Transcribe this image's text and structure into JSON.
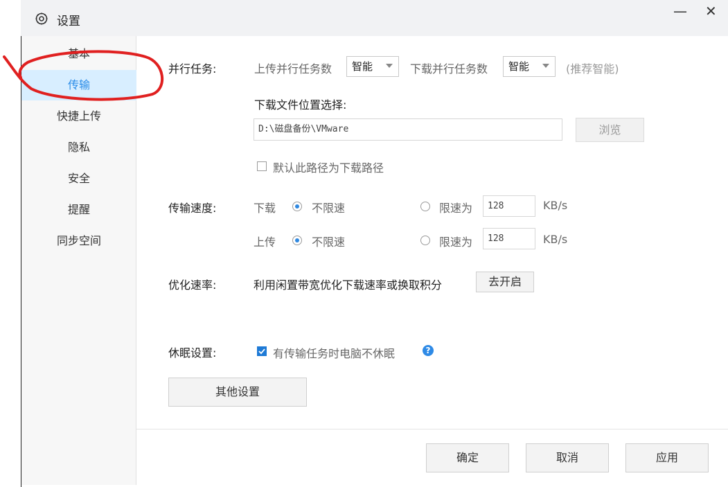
{
  "window": {
    "title": "设置",
    "minimize_glyph": "—",
    "close_glyph": "✕"
  },
  "sidebar": {
    "items": [
      {
        "label": "基本"
      },
      {
        "label": "传输"
      },
      {
        "label": "快捷上传"
      },
      {
        "label": "隐私"
      },
      {
        "label": "安全"
      },
      {
        "label": "提醒"
      },
      {
        "label": "同步空间"
      }
    ],
    "active": "传输"
  },
  "parallel": {
    "label": "并行任务:",
    "upload_label": "上传并行任务数",
    "upload_value": "智能",
    "download_label": "下载并行任务数",
    "download_value": "智能",
    "hint": "(推荐智能)"
  },
  "download_location": {
    "label": "下载文件位置选择:",
    "path": "D:\\磁盘备份\\VMware",
    "browse_label": "浏览",
    "default_checkbox_label": "默认此路径为下载路径",
    "default_checked": false
  },
  "speed": {
    "label": "传输速度:",
    "download": {
      "label": "下载",
      "unlimited_label": "不限速",
      "limit_label": "限速为",
      "limit_value": "128",
      "unit": "KB/s",
      "selected": "unlimited"
    },
    "upload": {
      "label": "上传",
      "unlimited_label": "不限速",
      "limit_label": "限速为",
      "limit_value": "128",
      "unit": "KB/s",
      "selected": "unlimited"
    }
  },
  "optimize": {
    "label": "优化速率:",
    "text": "利用闲置带宽优化下载速率或换取积分",
    "button_label": "去开启"
  },
  "sleep": {
    "label": "休眠设置:",
    "checkbox_label": "有传输任务时电脑不休眠",
    "checked": true,
    "help_glyph": "?"
  },
  "other_settings_label": "其他设置",
  "footer": {
    "ok_label": "确定",
    "cancel_label": "取消",
    "apply_label": "应用"
  },
  "colors": {
    "accent": "#2a8ce8",
    "annotation_red": "#e02020",
    "active_bg": "#d8eeff"
  }
}
